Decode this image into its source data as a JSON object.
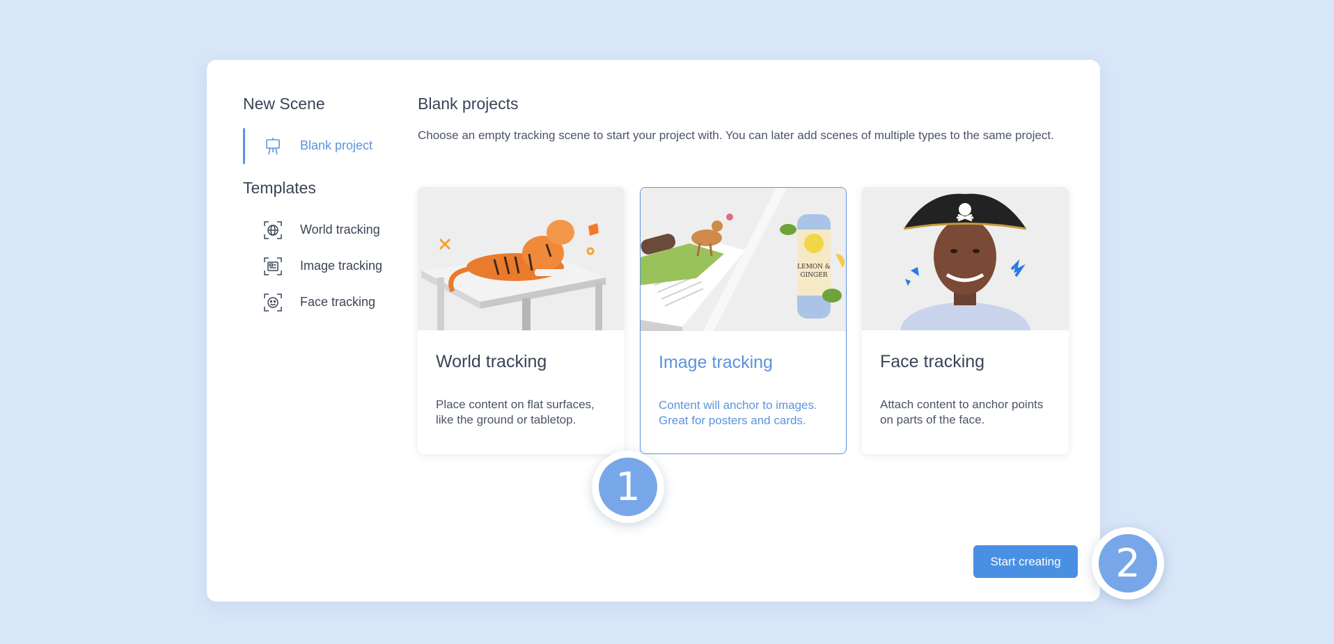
{
  "sidebar": {
    "new_scene_heading": "New Scene",
    "blank_item": {
      "label": "Blank project",
      "icon": "easel-icon"
    },
    "templates_heading": "Templates",
    "items": [
      {
        "label": "World tracking",
        "icon": "globe-icon"
      },
      {
        "label": "Image tracking",
        "icon": "image-icon"
      },
      {
        "label": "Face tracking",
        "icon": "face-icon"
      }
    ]
  },
  "main": {
    "title": "Blank projects",
    "description": "Choose an empty tracking scene to start your project with. You can later add scenes of multiple types to the same project.",
    "cards": [
      {
        "title": "World tracking",
        "description": "Place content on flat surfaces, like the ground or tabletop.",
        "selected": false
      },
      {
        "title": "Image tracking",
        "description": "Content will anchor to images. Great for posters and cards.",
        "selected": true
      },
      {
        "title": "Face tracking",
        "description": "Attach content to anchor points on parts of the face.",
        "selected": false
      }
    ],
    "can_label": "LEMON & GINGER",
    "start_button": "Start creating"
  },
  "badges": [
    "1",
    "2"
  ],
  "colors": {
    "accent": "#5b93dc",
    "button": "#4a90e2",
    "background": "#d8e6f8",
    "badge": "#77a7e8"
  }
}
